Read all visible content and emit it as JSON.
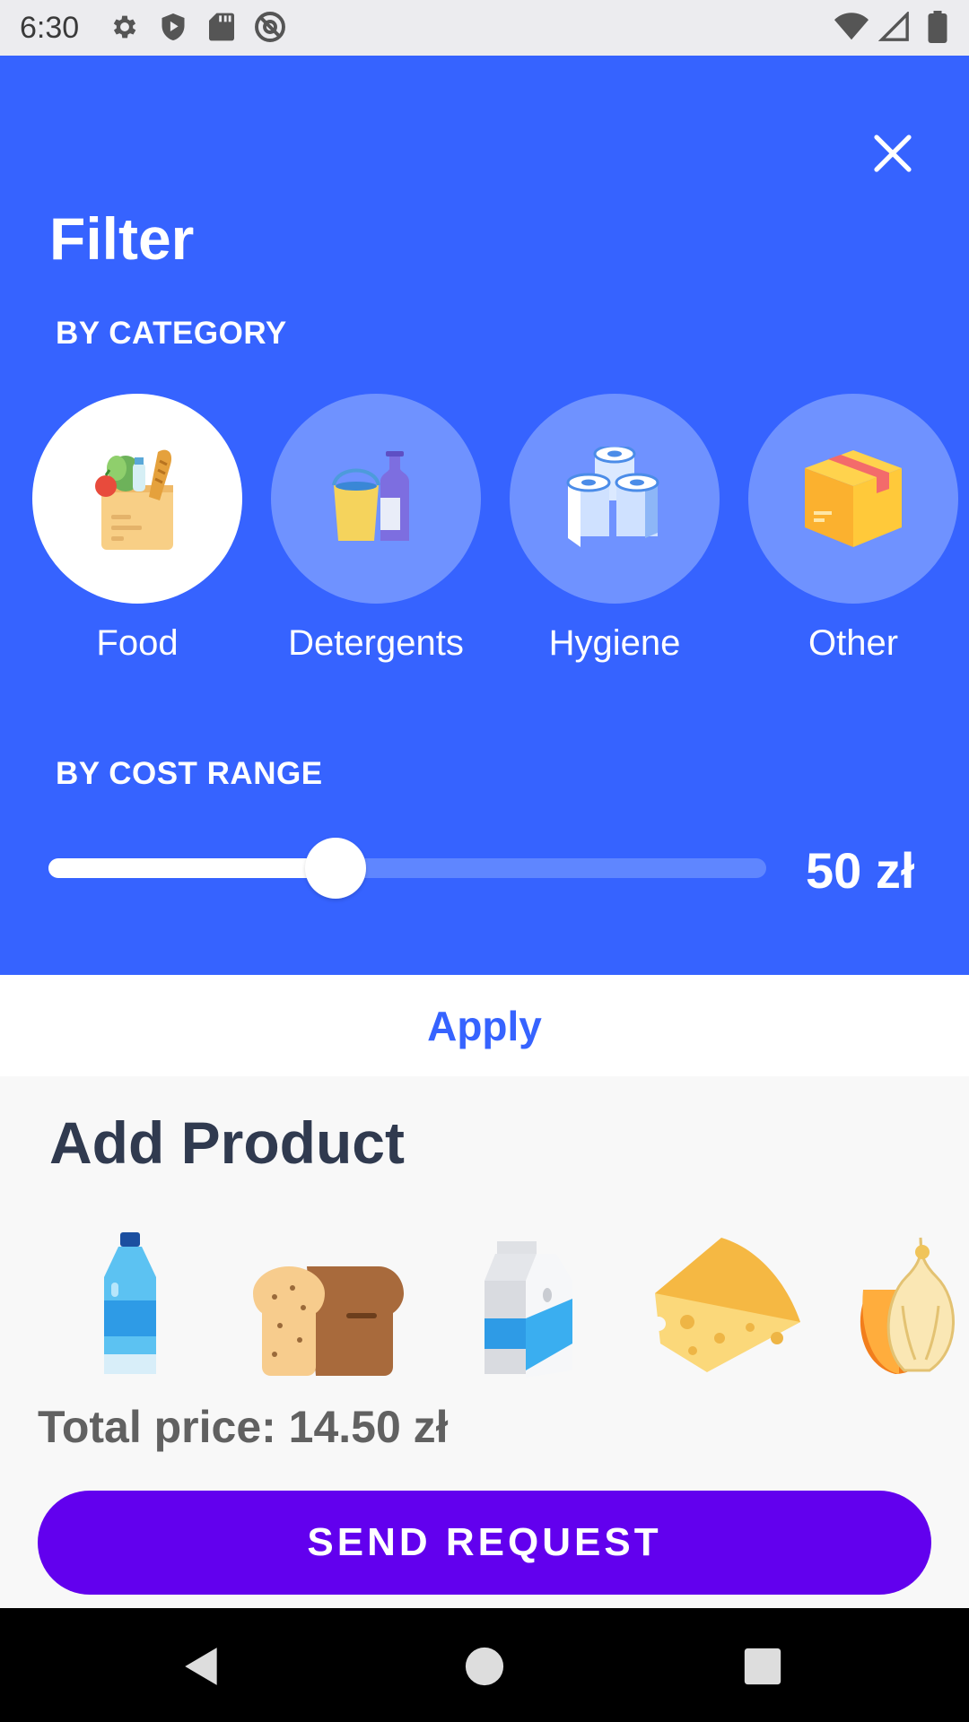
{
  "status_bar": {
    "time": "6:30",
    "icons_left": [
      "settings-icon",
      "shield-play-icon",
      "sd-card-icon",
      "at-sign-icon"
    ],
    "icons_right": [
      "wifi-icon",
      "cellular-signal-icon",
      "battery-icon"
    ]
  },
  "filter": {
    "title": "Filter",
    "category_label": "BY CATEGORY",
    "categories": [
      {
        "label": "Food",
        "icon": "grocery-bag-icon",
        "selected": true
      },
      {
        "label": "Detergents",
        "icon": "detergent-icon",
        "selected": false
      },
      {
        "label": "Hygiene",
        "icon": "toilet-paper-icon",
        "selected": false
      },
      {
        "label": "Other",
        "icon": "box-icon",
        "selected": false
      }
    ],
    "cost_label": "BY COST RANGE",
    "cost_value": "50 zł",
    "cost_slider_fraction": 0.4,
    "close_icon": "close-icon"
  },
  "apply": {
    "label": "Apply"
  },
  "add_product": {
    "title": "Add Product",
    "products": [
      {
        "icon": "water-bottle-icon"
      },
      {
        "icon": "bread-icon"
      },
      {
        "icon": "milk-carton-icon"
      },
      {
        "icon": "cheese-icon"
      },
      {
        "icon": "onion-icon"
      }
    ]
  },
  "total_price": "Total price: 14.50 zł",
  "send_button": "SEND REQUEST",
  "colors": {
    "filter_bg": "#3663ff",
    "category_circle": "#6f92ff",
    "apply_text": "#3663ff",
    "send_button": "#6200ee",
    "heading": "#303a4f"
  },
  "nav_bar": {
    "icons": [
      "back-icon",
      "home-icon",
      "recents-icon"
    ]
  }
}
